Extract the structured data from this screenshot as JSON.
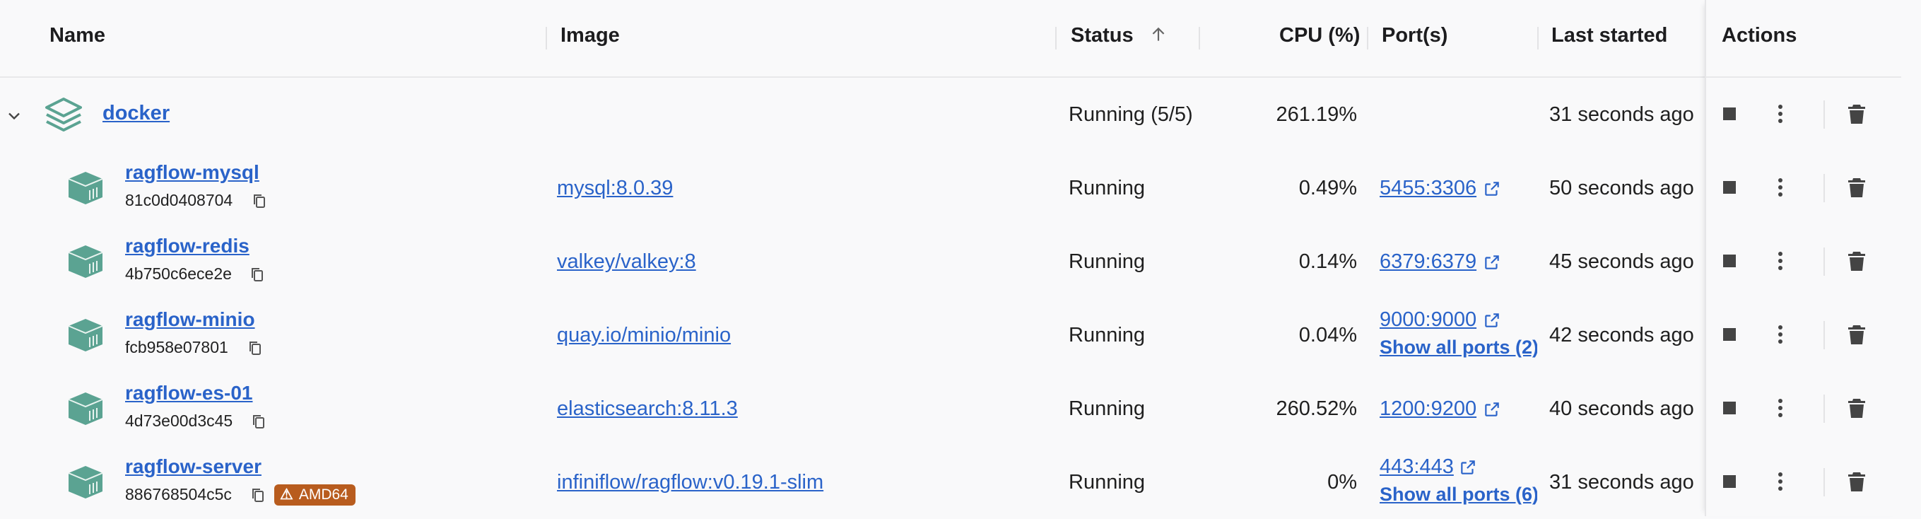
{
  "columns": {
    "name": "Name",
    "image": "Image",
    "status": "Status",
    "cpu": "CPU (%)",
    "ports": "Port(s)",
    "last_started": "Last started",
    "actions": "Actions"
  },
  "group": {
    "name": "docker",
    "status": "Running (5/5)",
    "cpu": "261.19%",
    "last_started": "31 seconds ago"
  },
  "containers": [
    {
      "name": "ragflow-mysql",
      "id": "81c0d0408704",
      "image": "mysql:8.0.39",
      "status": "Running",
      "cpu": "0.49%",
      "port": "5455:3306",
      "show_all": "",
      "last_started": "50 seconds ago",
      "badge": ""
    },
    {
      "name": "ragflow-redis",
      "id": "4b750c6ece2e",
      "image": "valkey/valkey:8",
      "status": "Running",
      "cpu": "0.14%",
      "port": "6379:6379",
      "show_all": "",
      "last_started": "45 seconds ago",
      "badge": ""
    },
    {
      "name": "ragflow-minio",
      "id": "fcb958e07801",
      "image": "quay.io/minio/minio",
      "status": "Running",
      "cpu": "0.04%",
      "port": "9000:9000",
      "show_all": "Show all ports (2)",
      "last_started": "42 seconds ago",
      "badge": ""
    },
    {
      "name": "ragflow-es-01",
      "id": "4d73e00d3c45",
      "image": "elasticsearch:8.11.3",
      "status": "Running",
      "cpu": "260.52%",
      "port": "1200:9200",
      "show_all": "",
      "last_started": "40 seconds ago",
      "badge": ""
    },
    {
      "name": "ragflow-server",
      "id": "886768504c5c",
      "image": "infiniflow/ragflow:v0.19.1-slim",
      "status": "Running",
      "cpu": "0%",
      "port": "443:443",
      "show_all": "Show all ports (6)",
      "last_started": "31 seconds ago",
      "badge": "AMD64"
    }
  ],
  "icons": {
    "sort": "arrow-up-icon",
    "expand": "chevron-down-icon",
    "stack": "stack-icon",
    "container": "container-icon",
    "copy": "copy-icon",
    "external": "external-link-icon",
    "stop": "stop-icon",
    "more": "more-vertical-icon",
    "delete": "trash-icon",
    "warning": "warning-icon"
  },
  "colors": {
    "link": "#2a63c9",
    "container_icon": "#5ba392",
    "badge": "#b85c1e"
  }
}
